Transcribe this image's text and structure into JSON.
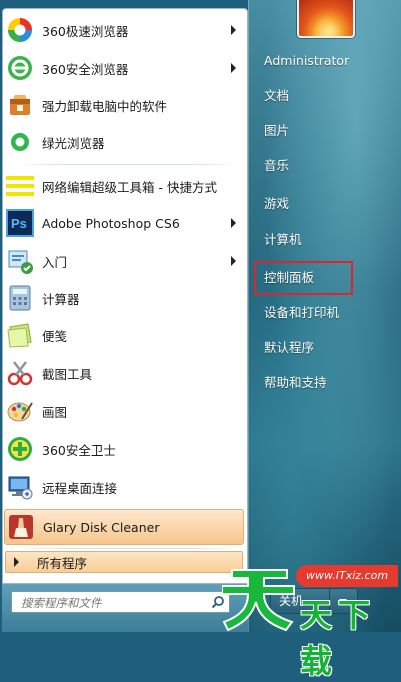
{
  "menu": {
    "pinned": [
      {
        "label": "360极速浏览器",
        "icon": "360-speed-browser-icon",
        "arrow": true
      },
      {
        "label": "360安全浏览器",
        "icon": "360-safe-browser-icon",
        "arrow": true
      },
      {
        "label": "强力卸载电脑中的软件",
        "icon": "uninstaller-icon",
        "arrow": false
      },
      {
        "label": "绿光浏览器",
        "icon": "green-light-browser-icon",
        "arrow": false
      }
    ],
    "recent": [
      {
        "label": "网络编辑超级工具箱 - 快捷方式",
        "icon": "toolbox-shortcut-icon",
        "arrow": false
      },
      {
        "label": "Adobe Photoshop CS6",
        "icon": "photoshop-icon",
        "arrow": true
      },
      {
        "label": "入门",
        "icon": "getting-started-icon",
        "arrow": true
      },
      {
        "label": "计算器",
        "icon": "calculator-icon",
        "arrow": false
      },
      {
        "label": "便笺",
        "icon": "sticky-notes-icon",
        "arrow": false
      },
      {
        "label": "截图工具",
        "icon": "snipping-tool-icon",
        "arrow": false
      },
      {
        "label": "画图",
        "icon": "paint-icon",
        "arrow": false
      },
      {
        "label": "360安全卫士",
        "icon": "360-security-icon",
        "arrow": false
      },
      {
        "label": "远程桌面连接",
        "icon": "remote-desktop-icon",
        "arrow": false
      },
      {
        "label": "Glary Disk Cleaner",
        "icon": "glary-disk-cleaner-icon",
        "arrow": false
      }
    ],
    "all_programs": "所有程序",
    "search_placeholder": "搜索程序和文件"
  },
  "right_panel": {
    "user": "Administrator",
    "items": [
      "文档",
      "图片",
      "音乐",
      "游戏",
      "计算机",
      "控制面板",
      "设备和打印机",
      "默认程序",
      "帮助和支持"
    ],
    "highlighted": "控制面板",
    "shutdown_label": "关机"
  },
  "watermark": {
    "url": "www.ITxiz.com",
    "brand": "天下载"
  },
  "colors": {
    "selected_bg": "#f9d2a4",
    "highlight_box": "#d8282e",
    "right_panel": "#2a6f86"
  }
}
